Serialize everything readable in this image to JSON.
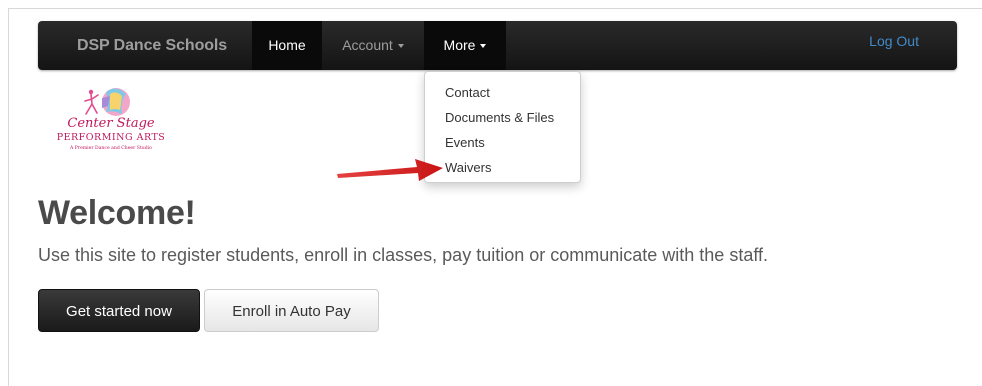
{
  "navbar": {
    "brand": "DSP Dance Schools",
    "items": [
      {
        "label": "Home",
        "active": true
      },
      {
        "label": "Account",
        "dropdown": true
      },
      {
        "label": "More",
        "dropdown": true,
        "open": true
      }
    ],
    "logout_label": "Log Out"
  },
  "more_menu": {
    "items": [
      "Contact",
      "Documents & Files",
      "Events",
      "Waivers"
    ]
  },
  "logo": {
    "line1": "Center Stage",
    "line2": "PERFORMING ARTS",
    "tagline": "A Premier Dance and Cheer Studio"
  },
  "hero": {
    "title": "Welcome!",
    "lead": "Use this site to register students, enroll in classes, pay tuition or communicate with the staff.",
    "primary_button": "Get started now",
    "secondary_button": "Enroll in Auto Pay"
  },
  "colors": {
    "navbar_bg": "#1e1e1e",
    "link": "#428bca",
    "annotation_arrow": "#e02020"
  }
}
